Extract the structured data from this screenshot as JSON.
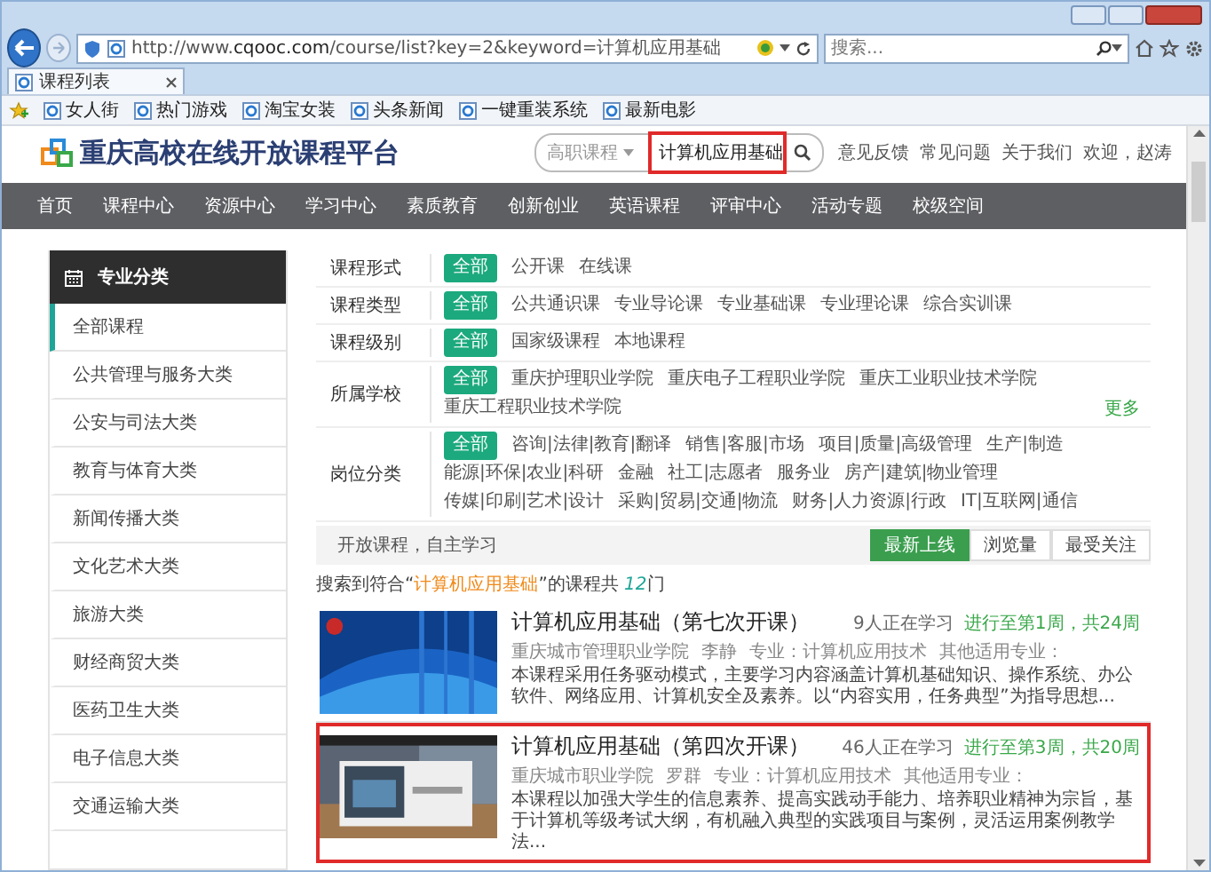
{
  "browser": {
    "address": "http://www.**cqooc.com**/course/list?key=2&keyword=计算机应用基础",
    "search_placeholder": "搜索...",
    "tabs": [
      {
        "label": "课程列表",
        "selected": true
      }
    ],
    "favorites": [
      "女人街",
      "热门游戏",
      "淘宝女装",
      "头条新闻",
      "一键重装系统",
      "最新电影"
    ]
  },
  "site": {
    "logo": "重庆高校在线开放课程平台",
    "search": {
      "category": "高职课程",
      "value": "计算机应用基础",
      "highlighted": true
    },
    "links": [
      "意见反馈",
      "常见问题",
      "关于我们",
      "欢迎，赵涛"
    ]
  },
  "nav": [
    "首页",
    "课程中心",
    "资源中心",
    "学习中心",
    "素质教育",
    "创新创业",
    "英语课程",
    "评审中心",
    "活动专题",
    "校级空间"
  ],
  "sidebar": {
    "title": "专业分类",
    "items": [
      {
        "label": "全部课程",
        "selected": true
      },
      {
        "label": "公共管理与服务大类",
        "selected": false
      },
      {
        "label": "公安与司法大类",
        "selected": false
      },
      {
        "label": "教育与体育大类",
        "selected": false
      },
      {
        "label": "新闻传播大类",
        "selected": false
      },
      {
        "label": "文化艺术大类",
        "selected": false
      },
      {
        "label": "旅游大类",
        "selected": false
      },
      {
        "label": "财经商贸大类",
        "selected": false
      },
      {
        "label": "医药卫生大类",
        "selected": false
      },
      {
        "label": "电子信息大类",
        "selected": false
      },
      {
        "label": "交通运输大类",
        "selected": false
      }
    ]
  },
  "filters": [
    {
      "label": "课程形式",
      "options": [
        {
          "text": "全部",
          "selected": true
        },
        {
          "text": "公开课",
          "selected": false
        },
        {
          "text": "在线课",
          "selected": false
        }
      ]
    },
    {
      "label": "课程类型",
      "options": [
        {
          "text": "全部",
          "selected": true
        },
        {
          "text": "公共通识课",
          "selected": false
        },
        {
          "text": "专业导论课",
          "selected": false
        },
        {
          "text": "专业基础课",
          "selected": false
        },
        {
          "text": "专业理论课",
          "selected": false
        },
        {
          "text": "综合实训课",
          "selected": false
        }
      ]
    },
    {
      "label": "课程级别",
      "options": [
        {
          "text": "全部",
          "selected": true
        },
        {
          "text": "国家级课程",
          "selected": false
        },
        {
          "text": "本地课程",
          "selected": false
        }
      ]
    },
    {
      "label": "所属学校",
      "options": [
        {
          "text": "全部",
          "selected": true
        },
        {
          "text": "重庆护理职业学院",
          "selected": false
        },
        {
          "text": "重庆电子工程职业学院",
          "selected": false
        },
        {
          "text": "重庆工业职业技术学院",
          "selected": false
        },
        {
          "text": "重庆工程职业技术学院",
          "selected": false
        }
      ],
      "more": "更多"
    },
    {
      "label": "岗位分类",
      "options": [
        {
          "text": "全部",
          "selected": true
        },
        {
          "text": "咨询|法律|教育|翻译",
          "selected": false
        },
        {
          "text": "销售|客服|市场",
          "selected": false
        },
        {
          "text": "项目|质量|高级管理",
          "selected": false
        },
        {
          "text": "生产|制造",
          "selected": false
        },
        {
          "text": "能源|环保|农业|科研",
          "selected": false
        },
        {
          "text": "金融",
          "selected": false
        },
        {
          "text": "社工|志愿者",
          "selected": false
        },
        {
          "text": "服务业",
          "selected": false
        },
        {
          "text": "房产|建筑|物业管理",
          "selected": false
        },
        {
          "text": "传媒|印刷|艺术|设计",
          "selected": false
        },
        {
          "text": "采购|贸易|交通|物流",
          "selected": false
        },
        {
          "text": "财务|人力资源|行政",
          "selected": false
        },
        {
          "text": "IT|互联网|通信",
          "selected": false
        }
      ]
    }
  ],
  "sort": {
    "slogan": "开放课程，自主学习",
    "options": [
      {
        "label": "最新上线",
        "selected": true
      },
      {
        "label": "浏览量",
        "selected": false
      },
      {
        "label": "最受关注",
        "selected": false
      }
    ]
  },
  "summary": {
    "before": "搜索到符合“",
    "keyword": "计算机应用基础",
    "middle": "”的课程共 ",
    "count": "12",
    "after": "门"
  },
  "courses": [
    {
      "title": "计算机应用基础（第七次开课）",
      "learners": "9人正在学习",
      "progress": "进行至第1周，共24周",
      "school": "重庆城市管理职业学院",
      "teacher": "李静",
      "major": "专业：计算机应用技术",
      "other": "其他适用专业：",
      "description": "本课程采用任务驱动模式，主要学习内容涵盖计算机基础知识、操作系统、办公软件、网络应用、计算机安全及素养。以“内容实用，任务典型”为指导思想...",
      "highlighted": false
    },
    {
      "title": "计算机应用基础（第四次开课）",
      "learners": "46人正在学习",
      "progress": "进行至第3周，共20周",
      "school": "重庆城市职业学院",
      "teacher": "罗群",
      "major": "专业：计算机应用技术",
      "other": "其他适用专业：",
      "description": "本课程以加强大学生的信息素养、提高实践动手能力、培养职业精神为宗旨，基于计算机等级考试大纲，有机融入典型的实践项目与案例，灵活运用案例教学法...",
      "highlighted": true
    }
  ]
}
